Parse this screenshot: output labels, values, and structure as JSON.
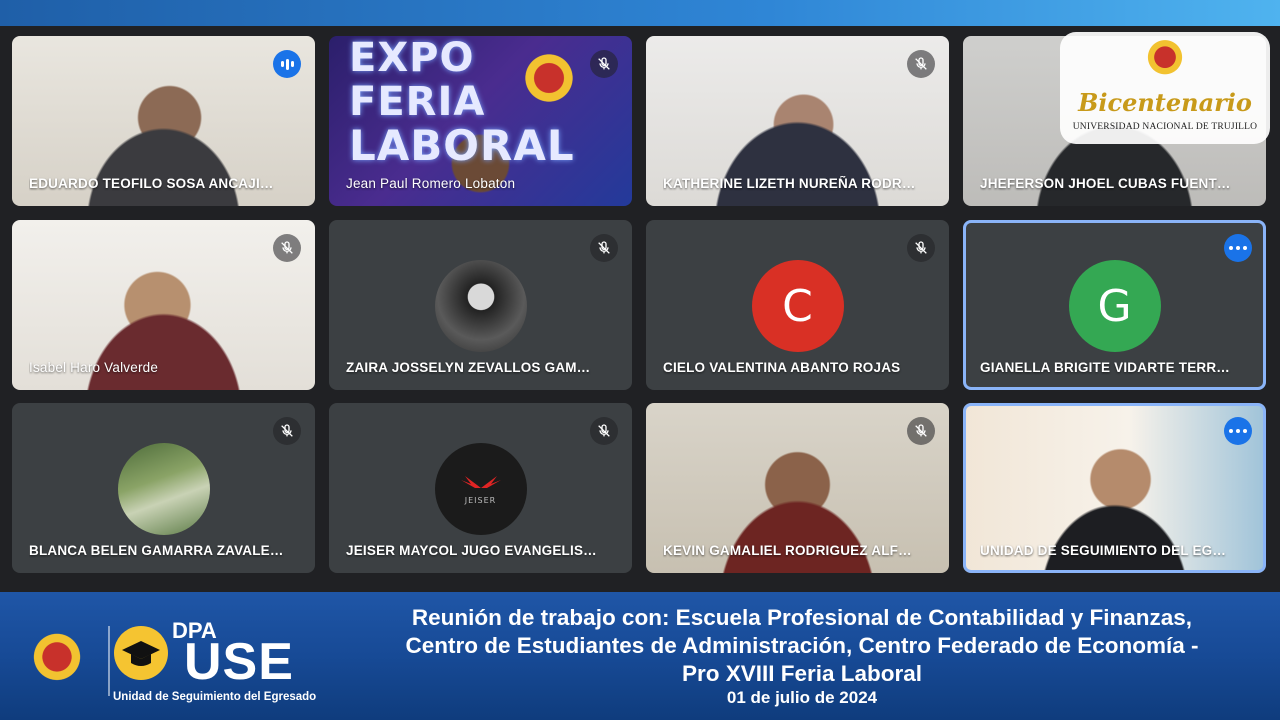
{
  "colors": {
    "accent": "#1a73e8",
    "tile_bg": "#3c4043",
    "banner": "#174a96",
    "gold": "#f5c431"
  },
  "participants": [
    {
      "name": "EDUARDO TEOFILO SOSA ANCAJI…",
      "status": "speaking"
    },
    {
      "name": "Jean Paul Romero Lobaton",
      "status": "muted"
    },
    {
      "name": "KATHERINE LIZETH NUREÑA RODR…",
      "status": "muted"
    },
    {
      "name": "JHEFERSON JHOEL CUBAS FUENT…",
      "status": "muted"
    },
    {
      "name": "Isabel Haro Valverde",
      "status": "muted"
    },
    {
      "name": "ZAIRA JOSSELYN ZEVALLOS GAM…",
      "status": "muted"
    },
    {
      "name": "CIELO VALENTINA ABANTO ROJAS",
      "status": "muted",
      "initial": "C",
      "color": "#d93025"
    },
    {
      "name": "GIANELLA BRIGITE VIDARTE TERR…",
      "status": "more",
      "initial": "G",
      "color": "#34a853"
    },
    {
      "name": "BLANCA BELEN GAMARRA ZAVALE…",
      "status": "muted"
    },
    {
      "name": "JEISER MAYCOL JUGO EVANGELIS…",
      "status": "muted"
    },
    {
      "name": "KEVIN GAMALIEL RODRIGUEZ ALF…",
      "status": "muted"
    },
    {
      "name": "UNIDAD DE SEGUIMIENTO DEL EG…",
      "status": "more"
    }
  ],
  "expo_banner": {
    "line1": "EXPO",
    "line2": "FERIA",
    "line3": "LABORAL"
  },
  "jeiser_avatar_text": "JEISER",
  "logo": {
    "title": "Bicentenario",
    "subtitle": "UNIVERSIDAD NACIONAL DE TRUJILLO"
  },
  "footer": {
    "dpa": "DPA",
    "use": "USE",
    "unit": "Unidad de Seguimiento del Egresado",
    "title_line1": "Reunión de trabajo con: Escuela Profesional de Contabilidad y Finanzas,",
    "title_line2": "Centro de Estudiantes de Administración, Centro Federado de Economía -",
    "title_line3": "Pro XVIII Feria Laboral",
    "date": "01 de julio de 2024"
  },
  "icons": {
    "mic_off": "mic-off-icon",
    "more": "more-options-icon",
    "speaking": "speaking-icon"
  }
}
